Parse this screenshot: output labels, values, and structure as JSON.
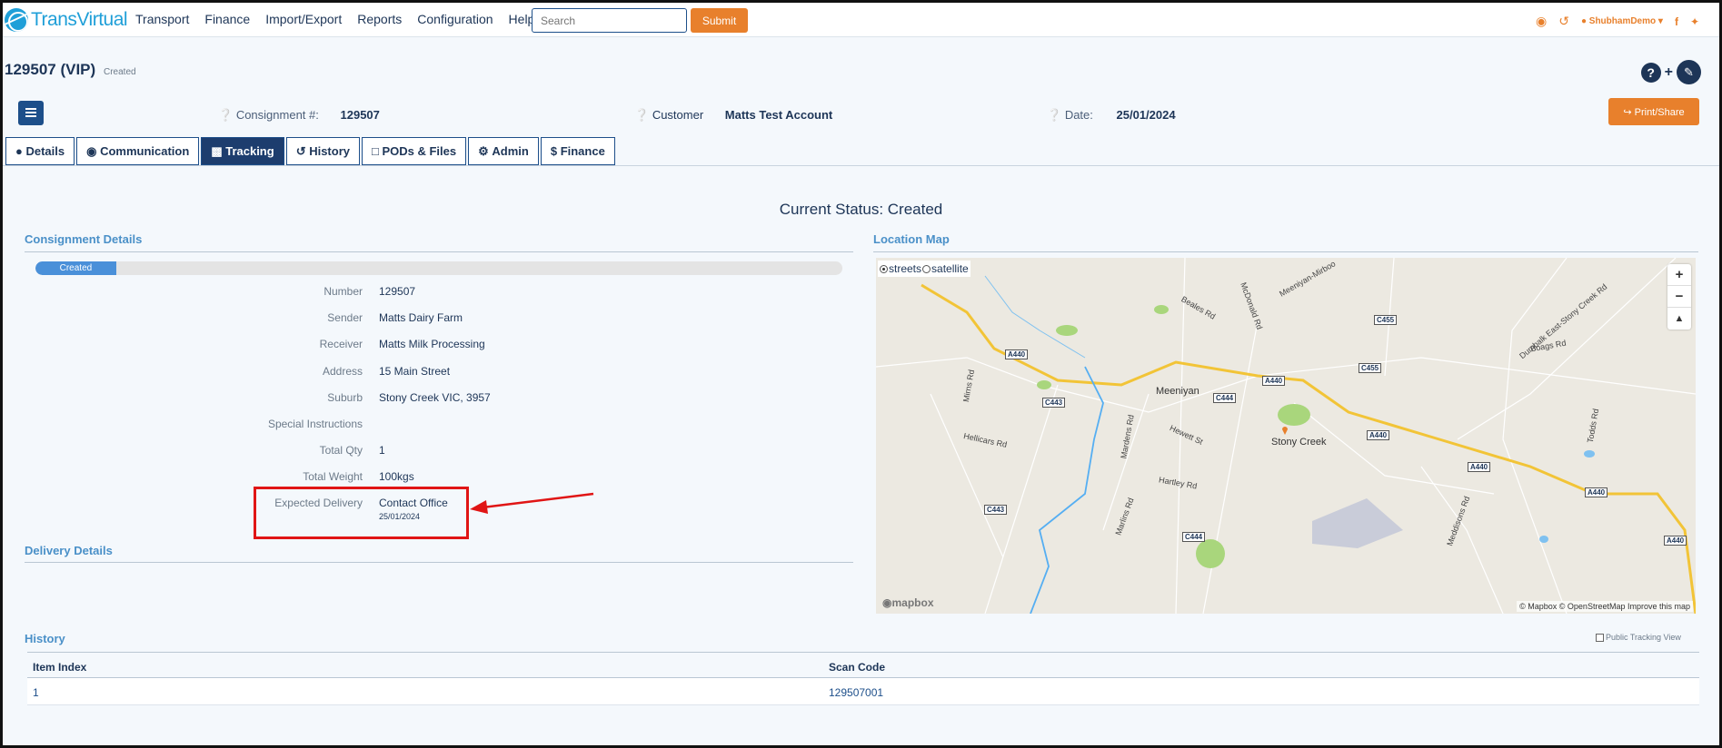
{
  "app": {
    "name_part1": "Trans",
    "name_part2": "Virtual"
  },
  "nav": {
    "menu": [
      "Transport",
      "Finance",
      "Import/Export",
      "Reports",
      "Configuration",
      "Help"
    ],
    "search_placeholder": "Search",
    "submit_label": "Submit",
    "user": "ShubhamDemo",
    "icons": [
      "chat-icon",
      "history-icon",
      "user-icon",
      "facebook-icon",
      "twitter-icon"
    ]
  },
  "header": {
    "title": "129507 (VIP)",
    "status": "Created"
  },
  "meta": {
    "consignment_label": "Consignment #:",
    "consignment_value": "129507",
    "customer_label": "Customer",
    "customer_value": "Matts Test Account",
    "date_label": "Date:",
    "date_value": "25/01/2024"
  },
  "print_label": "Print/Share",
  "tabs": [
    "Details",
    "Communication",
    "Tracking",
    "History",
    "PODs & Files",
    "Admin",
    "Finance"
  ],
  "active_tab": "Tracking",
  "current_status": "Current Status: Created",
  "consignment_details": {
    "heading": "Consignment Details",
    "progress_label": "Created",
    "progress_fraction": 0.1,
    "rows": [
      {
        "label": "Number",
        "value": "129507"
      },
      {
        "label": "Sender",
        "value": "Matts Dairy Farm"
      },
      {
        "label": "Receiver",
        "value": "Matts Milk Processing"
      },
      {
        "label": "Address",
        "value": "15 Main Street"
      },
      {
        "label": "Suburb",
        "value": "Stony Creek VIC, 3957"
      },
      {
        "label": "Special Instructions",
        "value": ""
      },
      {
        "label": "Total Qty",
        "value": "1"
      },
      {
        "label": "Total Weight",
        "value": "100kgs"
      },
      {
        "label": "Expected Delivery",
        "value": "Contact Office",
        "sub": "25/01/2024"
      }
    ]
  },
  "delivery_heading": "Delivery Details",
  "map": {
    "heading": "Location Map",
    "radio_streets": "streets",
    "radio_satellite": "satellite",
    "logo": "mapbox",
    "attribution": "© Mapbox © OpenStreetMap  Improve this map",
    "labels": {
      "town1": "Meeniyan",
      "town2": "Stony Creek",
      "road1": "Mirns Rd",
      "road2": "Hellicars Rd",
      "road3": "Hewett St",
      "road4": "Hartley Rd",
      "road5": "Mardens Rd",
      "road6": "Dumbalk East-Stony Creek Rd",
      "road7": "Boags Rd",
      "road8": "Todds Rd",
      "road9": "Meddisons Rd",
      "road10": "McDonald Rd",
      "road11": "Meeniyan-Mirboo",
      "road12": "Beales Rd",
      "road13": "Marlins Rd",
      "shield_a440": "A440",
      "shield_c443": "C443",
      "shield_c444": "C444",
      "shield_c455": "C455"
    }
  },
  "history": {
    "heading": "History",
    "public_label": "Public Tracking View",
    "columns": [
      "Item Index",
      "Scan Code"
    ],
    "rows": [
      {
        "index": "1",
        "scan": "129507001"
      }
    ]
  }
}
